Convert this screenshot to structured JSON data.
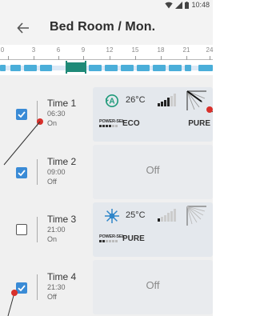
{
  "status_bar": {
    "time": "10:48"
  },
  "header": {
    "title": "Bed Room / Mon."
  },
  "timeline": {
    "hour_labels": [
      "0",
      "3",
      "6",
      "9",
      "12",
      "15",
      "18",
      "21",
      "24"
    ]
  },
  "schedule": [
    {
      "name": "Time 1",
      "time": "06:30",
      "state": "On",
      "checked": true,
      "card": {
        "off": false,
        "mode_icon": "auto-mode-icon",
        "temperature": "26°C",
        "fan_level": 3,
        "power_sel_label": "POWER-SEL",
        "mode_label": "ECO",
        "right_label": "PURE"
      }
    },
    {
      "name": "Time 2",
      "time": "09:00",
      "state": "Off",
      "checked": true,
      "card": {
        "off": true,
        "off_label": "Off"
      }
    },
    {
      "name": "Time 3",
      "time": "21:00",
      "state": "On",
      "checked": false,
      "card": {
        "off": false,
        "mode_icon": "heat-mode-icon",
        "temperature": "25°C",
        "fan_level": 1,
        "power_sel_label": "POWER-SEL",
        "mode_label": "PURE"
      }
    },
    {
      "name": "Time 4",
      "time": "21:30",
      "state": "Off",
      "checked": true,
      "card": {
        "off": true,
        "off_label": "Off"
      }
    }
  ],
  "colors": {
    "accent_blue": "#3a8bd6",
    "timeline_segment": "#4aaed9",
    "timeline_active": "#1f8a78",
    "callout_red": "#d8302b",
    "mode_green": "#1f9a7a"
  }
}
